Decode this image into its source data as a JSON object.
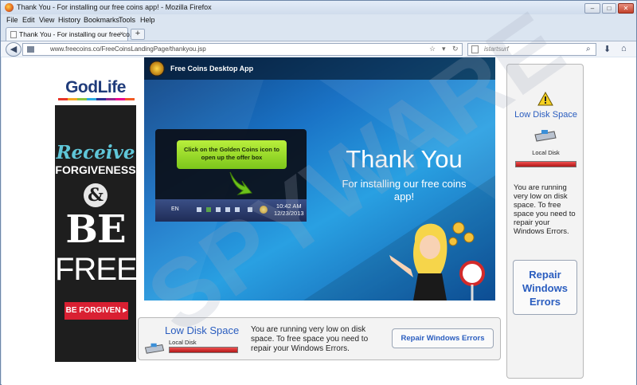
{
  "window": {
    "title": "Thank You - For installing our free coins app! - Mozilla Firefox",
    "minimize": "–",
    "maximize": "□",
    "close": "✕"
  },
  "menu": [
    "File",
    "Edit",
    "View",
    "History",
    "Bookmarks",
    "Tools",
    "Help"
  ],
  "tab": {
    "label": "Thank You - For installing our free co...",
    "close": "×",
    "new": "+"
  },
  "nav": {
    "url": "www.freecoins.co/FreeCoinsLandingPage/thankyou.jsp",
    "search_engine": "istartsurf",
    "back": "◀"
  },
  "left_ad": {
    "brand": "GodLife",
    "receive": "Receive",
    "forgiveness": "FORGIVENESS",
    "amp": "&",
    "be": "BE",
    "free": "FREE!",
    "button": "BE FORGIVEN ▸",
    "stripe_colors": [
      "#e8362a",
      "#f5a623",
      "#8bc53f",
      "#29abe2",
      "#2e3192",
      "#92278f",
      "#ec008c",
      "#f15a24"
    ]
  },
  "main_ad": {
    "app_name": "Free Coins Desktop App",
    "tooltip_line1": "Click on the Golden Coins icon to",
    "tooltip_line2": "open up the offer box",
    "tray_lang": "EN",
    "tray_time": "10:42 AM",
    "tray_date": "12/23/2013",
    "thank_title": "Thank You",
    "thank_sub1": "For installing our free coins",
    "thank_sub2": "app!"
  },
  "right_ad": {
    "low_disk": "Low Disk Space",
    "local_disk": "Local Disk",
    "msg": "You are running very low on disk space. To free space you need to repair your Windows Errors.",
    "repair_line1": "Repair",
    "repair_line2": "Windows",
    "repair_line3": "Errors"
  },
  "bottom_ad": {
    "low_disk": "Low Disk Space",
    "local_disk": "Local Disk",
    "msg": "You are running very low on disk space.  To free space you need to repair your Windows Errors.",
    "repair": "Repair Windows Errors"
  },
  "colors": {
    "accent_blue": "#2a5dbf",
    "warning_red": "#d92032",
    "tooltip_green": "#7cc61b"
  }
}
